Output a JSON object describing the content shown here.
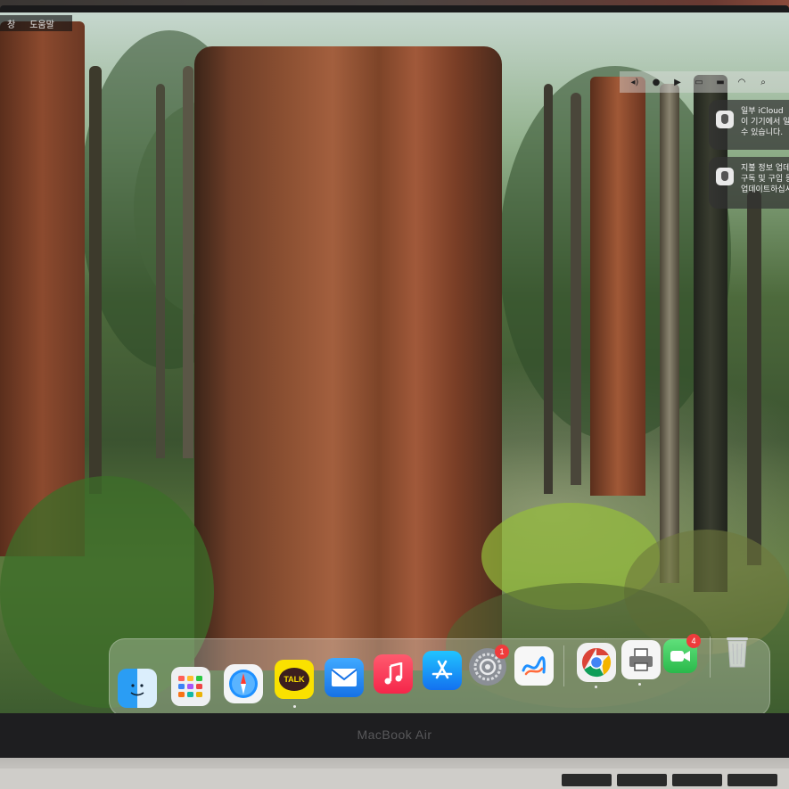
{
  "menubar": {
    "items": [
      "창",
      "도움말"
    ]
  },
  "status_bar": {
    "icons": [
      "volume-icon",
      "focus-icon",
      "play-icon",
      "display-icon",
      "battery-icon",
      "wifi-icon",
      "search-icon"
    ]
  },
  "notifications": [
    {
      "app_icon": "apple-icon",
      "lines": [
        "일부 iCloud",
        "이 기기에서 일",
        "수 있습니다."
      ]
    },
    {
      "app_icon": "apple-icon",
      "lines": [
        "지불 정보 업데",
        "구독 및 구입 등",
        "업데이트하십시"
      ]
    }
  ],
  "dock": {
    "apps": [
      {
        "name": "Finder",
        "icon": "finder-icon",
        "running": true,
        "badge": null
      },
      {
        "name": "Launchpad",
        "icon": "launchpad-icon",
        "running": false,
        "badge": null
      },
      {
        "name": "Safari",
        "icon": "safari-icon",
        "running": false,
        "badge": null
      },
      {
        "name": "KakaoTalk",
        "icon": "kakaotalk-icon",
        "label": "TALK",
        "running": true,
        "badge": null
      },
      {
        "name": "Mail",
        "icon": "mail-icon",
        "running": false,
        "badge": null
      },
      {
        "name": "Music",
        "icon": "music-icon",
        "running": false,
        "badge": null
      },
      {
        "name": "App Store",
        "icon": "app-store-icon",
        "running": false,
        "badge": null
      },
      {
        "name": "System Settings",
        "icon": "system-settings-icon",
        "running": false,
        "badge": "1"
      },
      {
        "name": "Freeform",
        "icon": "freeform-icon",
        "running": false,
        "badge": null
      },
      {
        "name": "Chrome",
        "icon": "chrome-icon",
        "running": true,
        "badge": null
      },
      {
        "name": "Printer",
        "icon": "printer-icon",
        "running": true,
        "badge": null
      },
      {
        "name": "FaceTime",
        "icon": "facetime-icon",
        "running": false,
        "badge": "4"
      },
      {
        "name": "Trash",
        "icon": "trash-icon",
        "running": false,
        "badge": null
      }
    ]
  },
  "device": {
    "label": "MacBook Air"
  },
  "colors": {
    "badge": "#ef3b3b",
    "kakao": "#fae100",
    "chrome_red": "#db4437",
    "facetime": "#34c759"
  }
}
